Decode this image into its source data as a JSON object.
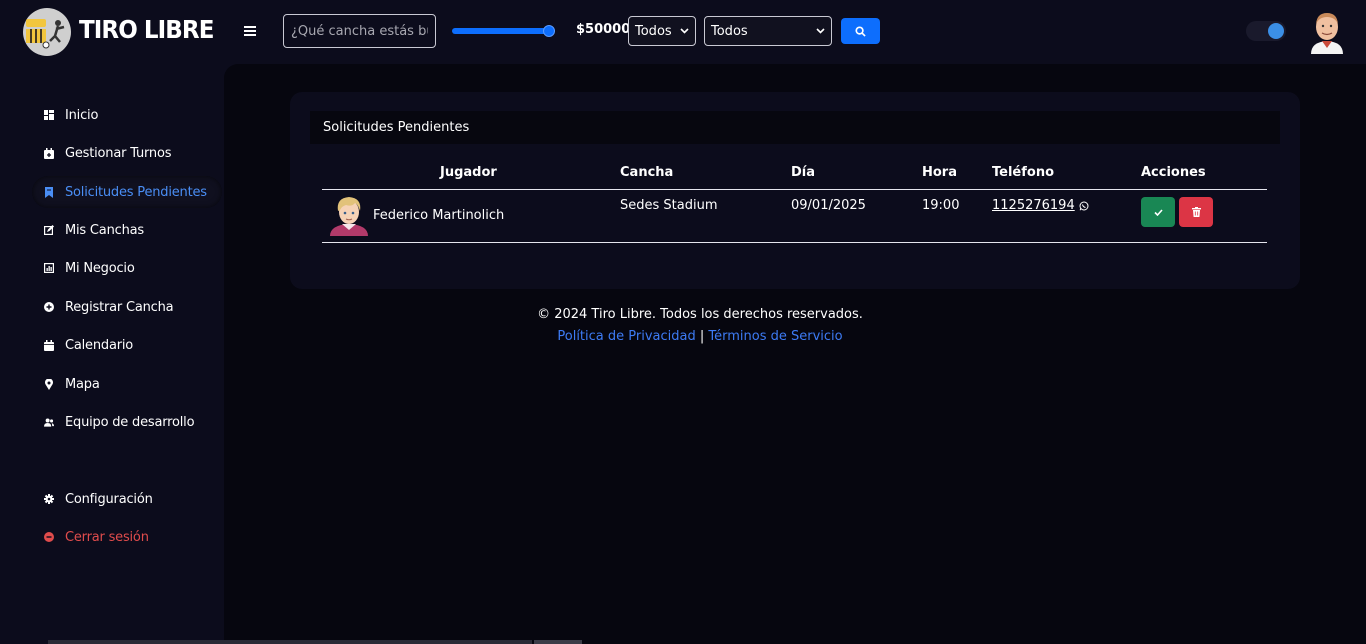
{
  "header": {
    "brand": "TIRO LIBRE",
    "search_placeholder": "¿Qué cancha estás buscando?",
    "price_label": "$50000",
    "price_slider_fraction": 1.0,
    "filter1_value": "Todos",
    "filter2_value": "Todos",
    "accent_color": "#0d6efd"
  },
  "sidebar": {
    "items": [
      {
        "label": "Inicio",
        "icon": "dashboard-icon"
      },
      {
        "label": "Gestionar Turnos",
        "icon": "calendar-plus-icon"
      },
      {
        "label": "Solicitudes Pendientes",
        "icon": "bookmark-icon"
      },
      {
        "label": "Mis Canchas",
        "icon": "edit-icon"
      },
      {
        "label": "Mi Negocio",
        "icon": "chart-icon"
      },
      {
        "label": "Registrar Cancha",
        "icon": "plus-circle-icon"
      },
      {
        "label": "Calendario",
        "icon": "calendar-icon"
      },
      {
        "label": "Mapa",
        "icon": "map-pin-icon"
      },
      {
        "label": "Equipo de desarrollo",
        "icon": "users-icon"
      }
    ],
    "settings_label": "Configuración",
    "logout_label": "Cerrar sesión",
    "active_color": "#4a8ef5",
    "logout_color": "#e04c4c"
  },
  "main": {
    "card_title": "Solicitudes Pendientes",
    "columns": [
      "Jugador",
      "Cancha",
      "Día",
      "Hora",
      "Teléfono",
      "Acciones"
    ],
    "rows": [
      {
        "player": "Federico Martinolich",
        "court": "Sedes Stadium",
        "date": "09/01/2025",
        "time": "19:00",
        "phone": "1125276194"
      }
    ]
  },
  "footer": {
    "copyright": "© 2024 Tiro Libre. Todos los derechos reservados.",
    "privacy_link": "Política de Privacidad",
    "separator": "|",
    "terms_link": "Términos de Servicio"
  }
}
